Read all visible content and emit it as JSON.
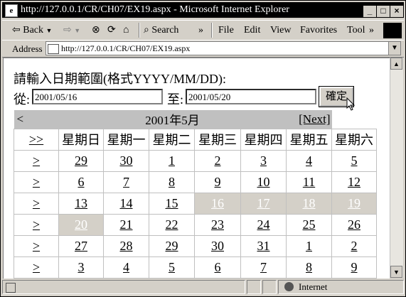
{
  "window": {
    "title": "http://127.0.0.1/CR/CH07/EX19.aspx - Microsoft Internet Explorer"
  },
  "toolbar": {
    "back": "Back",
    "search": "Search",
    "chevron1": "»",
    "menus": [
      "File",
      "Edit",
      "View",
      "Favorites",
      "Tool"
    ],
    "chevron2": "»"
  },
  "address": {
    "label": "Address",
    "url": "http://127.0.0.1/CR/CH07/EX19.aspx"
  },
  "form": {
    "prompt": "請輸入日期範圍(格式YYYY/MM/DD):",
    "from_label": "從:",
    "from_value": "2001/05/16",
    "to_label": "至:",
    "to_value": "2001/05/20",
    "ok_label": "確定"
  },
  "calendar": {
    "prev": "<",
    "title": "2001年5月",
    "next": "[Next]",
    "select_month": ">>",
    "days": [
      "星期日",
      "星期一",
      "星期二",
      "星期三",
      "星期四",
      "星期五",
      "星期六"
    ],
    "week_select": ">",
    "weeks": [
      [
        "29",
        "30",
        "1",
        "2",
        "3",
        "4",
        "5"
      ],
      [
        "6",
        "7",
        "8",
        "9",
        "10",
        "11",
        "12"
      ],
      [
        "13",
        "14",
        "15",
        "16",
        "17",
        "18",
        "19"
      ],
      [
        "20",
        "21",
        "22",
        "23",
        "24",
        "25",
        "26"
      ],
      [
        "27",
        "28",
        "29",
        "30",
        "31",
        "1",
        "2"
      ],
      [
        "3",
        "4",
        "5",
        "6",
        "7",
        "8",
        "9"
      ]
    ],
    "selected": [
      "16",
      "17",
      "18",
      "19",
      "20"
    ]
  },
  "status": {
    "zone": "Internet"
  }
}
